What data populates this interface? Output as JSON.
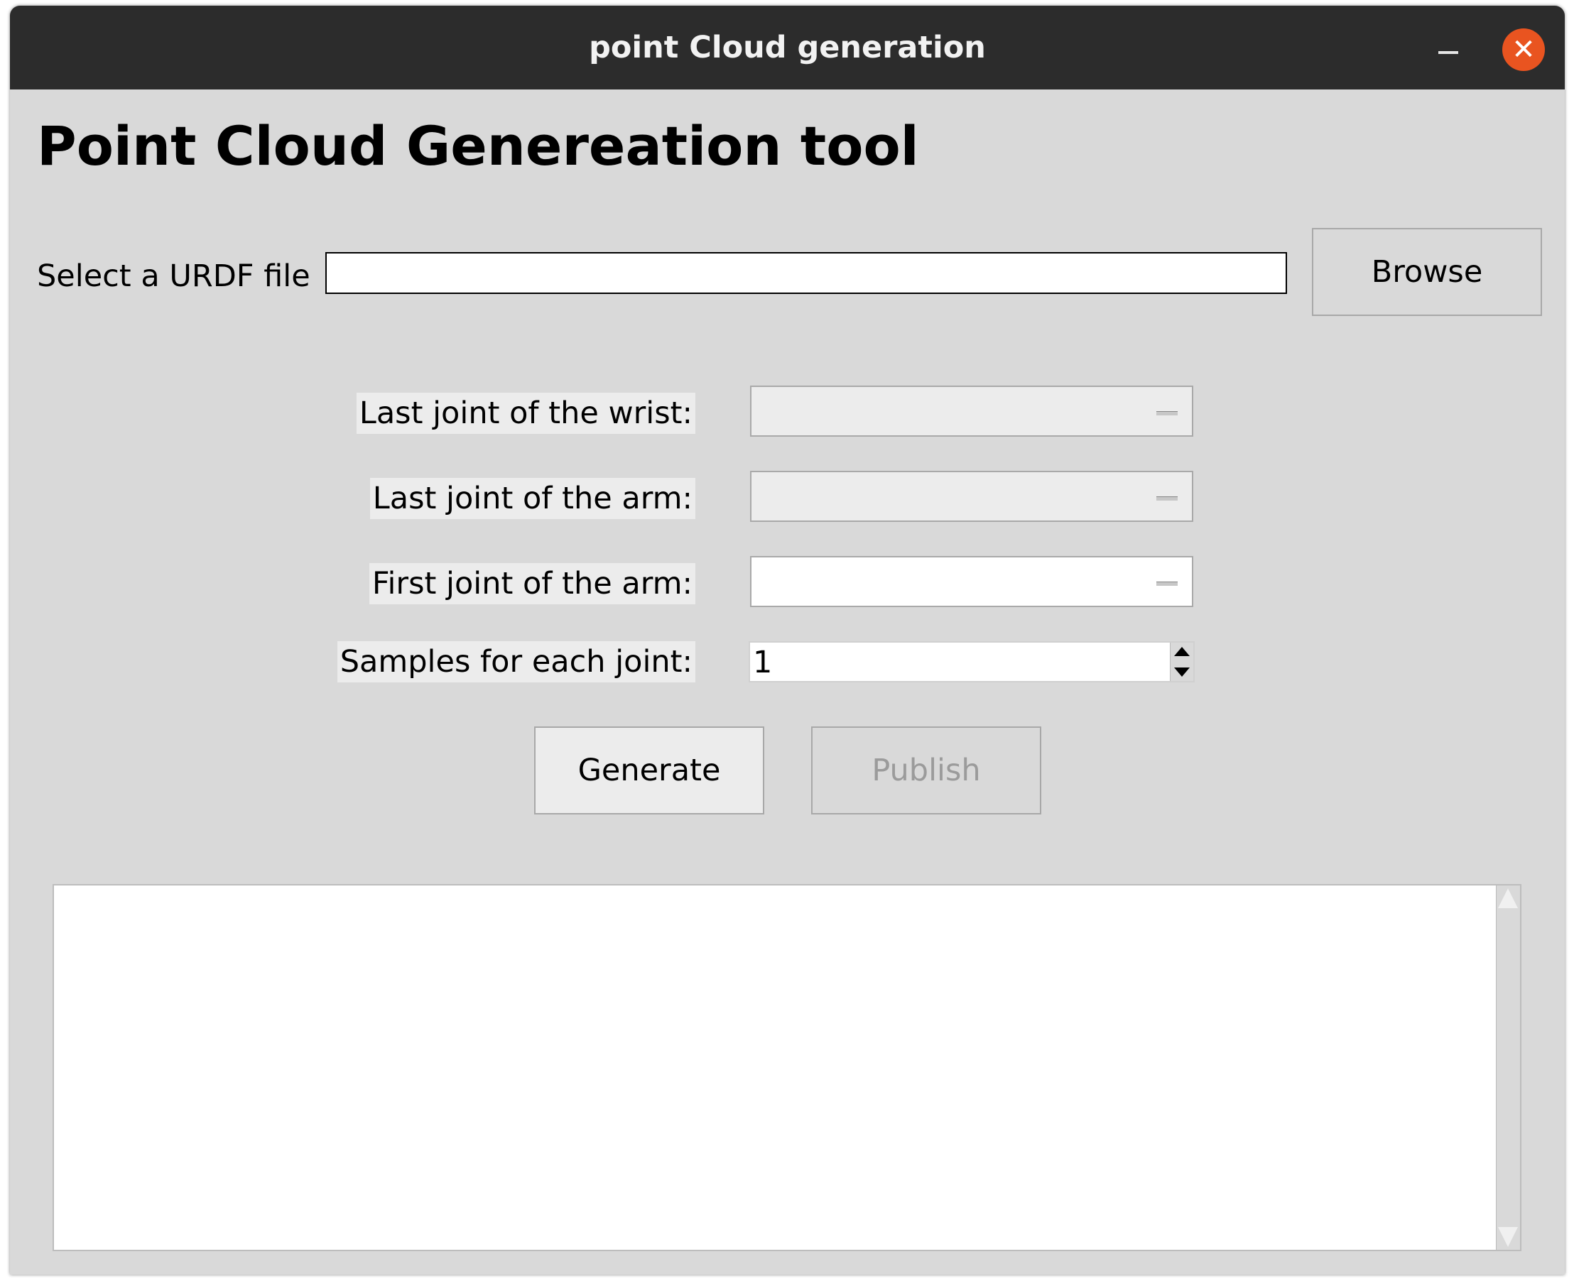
{
  "window": {
    "title": "point Cloud generation",
    "close_glyph": "✕",
    "accent_color": "#e95420"
  },
  "heading": "Point Cloud Genereation tool",
  "file": {
    "label": "Select a URDF file",
    "value": "",
    "browse_label": "Browse"
  },
  "form": {
    "wrist_label": "Last joint of the wrist:",
    "wrist_value": "",
    "arm_last_label": "Last joint of the arm:",
    "arm_last_value": "",
    "arm_first_label": "First joint of the arm:",
    "arm_first_value": "",
    "samples_label": "Samples for each joint:",
    "samples_value": "1"
  },
  "actions": {
    "generate_label": "Generate",
    "publish_label": "Publish"
  },
  "output": {
    "text": ""
  }
}
